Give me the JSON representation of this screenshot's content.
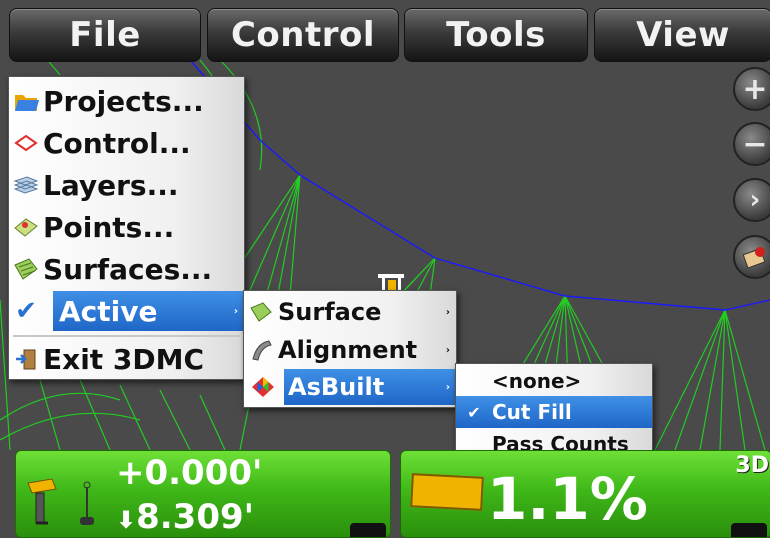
{
  "menubar": [
    "File",
    "Control",
    "Tools",
    "View"
  ],
  "file_menu": {
    "items": [
      {
        "label": "Projects...",
        "icon": "folder-icon"
      },
      {
        "label": "Control...",
        "icon": "control-diamond-icon"
      },
      {
        "label": "Layers...",
        "icon": "layers-icon"
      },
      {
        "label": "Points...",
        "icon": "points-icon"
      },
      {
        "label": "Surfaces...",
        "icon": "surfaces-icon"
      },
      {
        "label": "Active",
        "icon": "check-icon",
        "selected": true
      },
      {
        "label": "Exit 3DMC",
        "icon": "exit-door-icon"
      }
    ]
  },
  "active_menu": {
    "items": [
      {
        "label": "Surface",
        "icon": "surface-icon"
      },
      {
        "label": "Alignment",
        "icon": "alignment-icon"
      },
      {
        "label": "AsBuilt",
        "icon": "asbuilt-icon",
        "selected": true
      }
    ]
  },
  "asbuilt_menu": {
    "items": [
      {
        "label": "<none>"
      },
      {
        "label": "Cut Fill",
        "checked": true
      },
      {
        "label": "Pass Counts"
      }
    ]
  },
  "side_tools": [
    "zoom-in-icon",
    "zoom-out-icon",
    "next-icon",
    "machine-view-icon"
  ],
  "status_left": {
    "top_value": "+0.000'",
    "bottom_value": "8.309'"
  },
  "status_right": {
    "grade_value": "1.1%",
    "mode": "3D"
  },
  "colors": {
    "panel_green": "#3fb818",
    "highlight_blue": "#2a7ad8",
    "alignment_line": "#1a1aff",
    "grid_line": "#22cc22",
    "grade_bar": "#f0b400"
  }
}
